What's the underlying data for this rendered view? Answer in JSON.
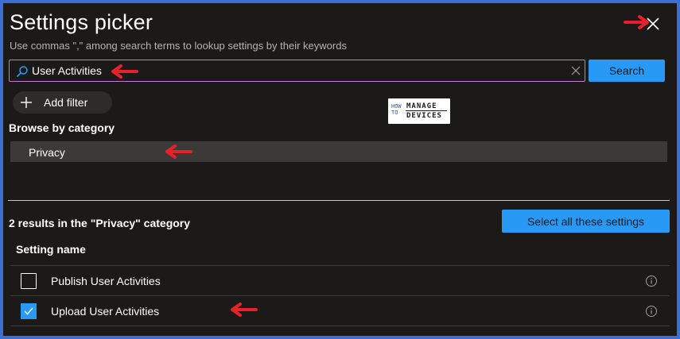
{
  "header": {
    "title": "Settings picker",
    "subtitle": "Use commas \",\" among search terms to lookup settings by their keywords",
    "close_icon": "close-icon"
  },
  "search": {
    "value": "User Activities",
    "placeholder": "",
    "button_label": "Search",
    "icon": "search-icon",
    "clear_icon": "clear-icon"
  },
  "filter": {
    "add_filter_label": "Add filter",
    "icon": "plus-icon"
  },
  "logo": {
    "line1a": "HOW",
    "line1b": "TO",
    "line2": "MANAGE",
    "line3": "DEVICES"
  },
  "browse": {
    "heading": "Browse by category",
    "categories": [
      {
        "label": "Privacy",
        "selected": true
      }
    ]
  },
  "results": {
    "heading": "2 results in the \"Privacy\" category",
    "select_all_label": "Select all these settings",
    "column_header": "Setting name",
    "rows": [
      {
        "label": "Publish User Activities",
        "checked": false,
        "info_icon": "info-icon"
      },
      {
        "label": "Upload User Activities",
        "checked": true,
        "info_icon": "info-icon"
      }
    ]
  },
  "colors": {
    "frame": "#3b6fd6",
    "panel_bg": "#1b1a19",
    "accent": "#2899f5",
    "search_border": "#c37ad6",
    "annotation_arrow": "#e8202a"
  }
}
